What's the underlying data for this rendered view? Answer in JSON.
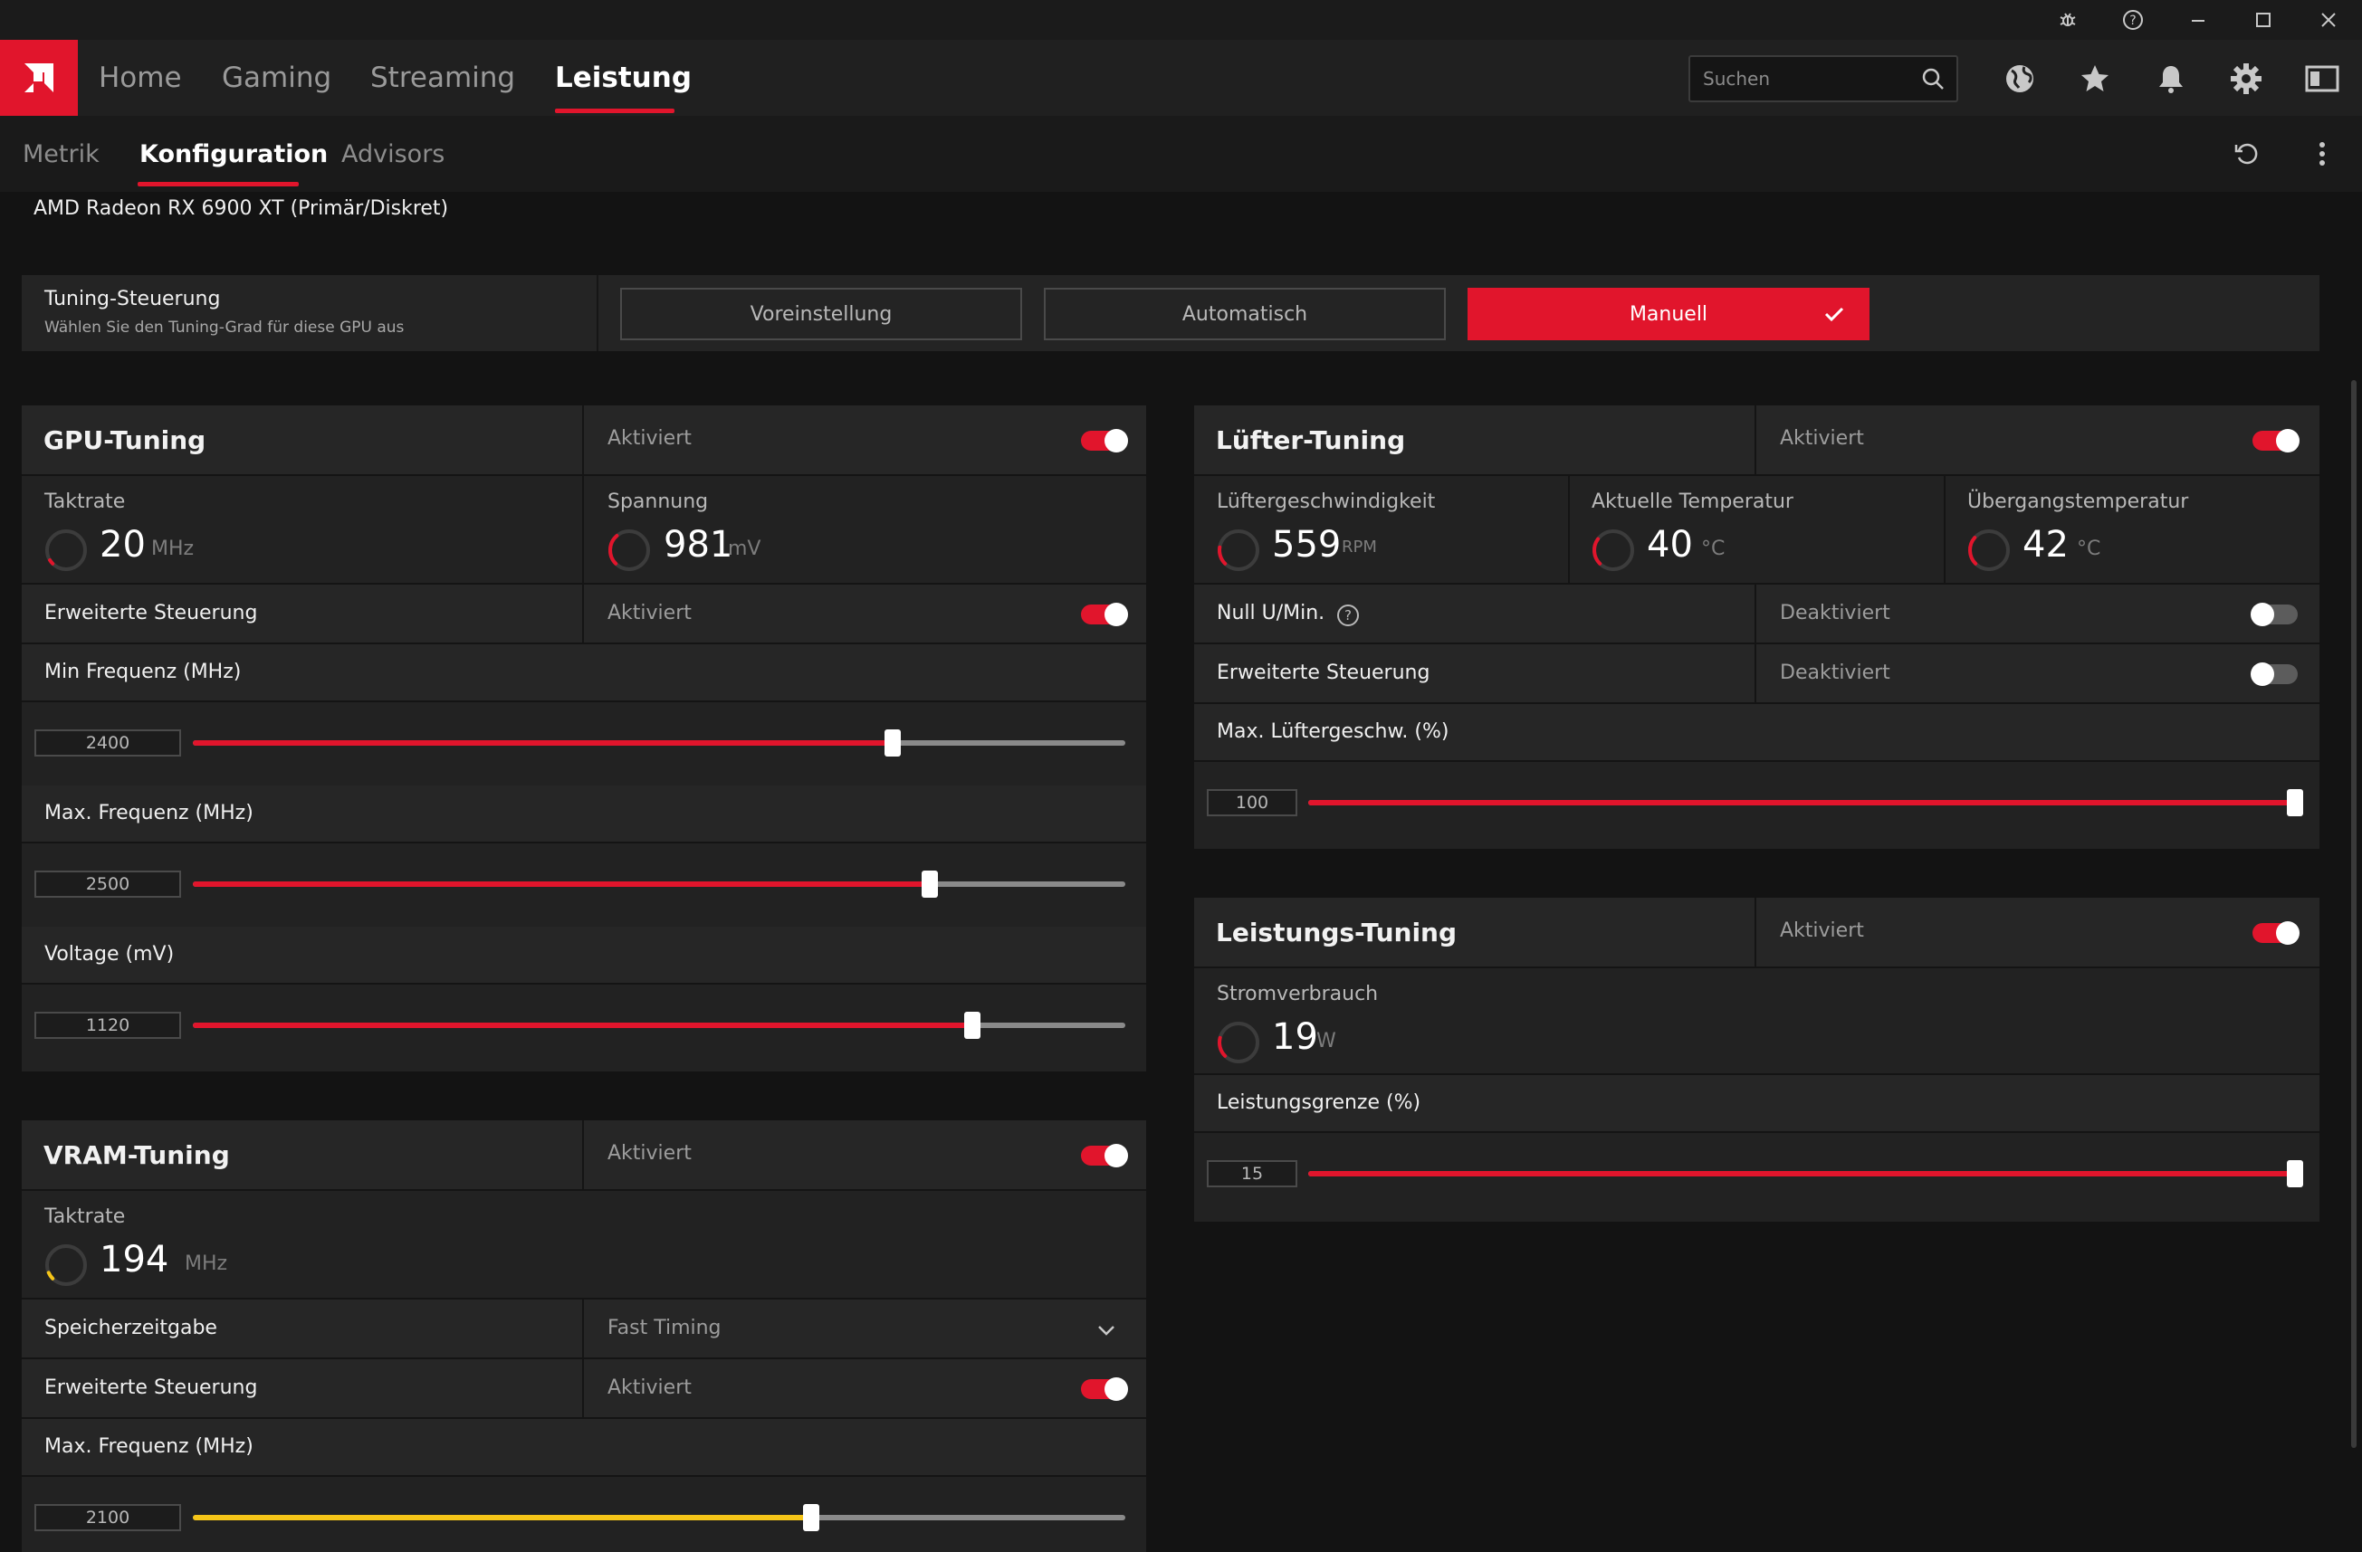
{
  "colors": {
    "accent": "#e1152c",
    "vram_accent": "#f5c518",
    "background": "#131313",
    "panel": "#222222"
  },
  "titlebar": {
    "icons": [
      "bug-icon",
      "help-icon",
      "minimize-icon",
      "maximize-icon",
      "close-icon"
    ]
  },
  "nav": {
    "tabs": [
      {
        "label": "Home",
        "active": false
      },
      {
        "label": "Gaming",
        "active": false
      },
      {
        "label": "Streaming",
        "active": false
      },
      {
        "label": "Leistung",
        "active": true
      }
    ]
  },
  "search": {
    "placeholder": "Suchen",
    "value": ""
  },
  "top_icons": [
    "globe-icon",
    "star-icon",
    "bell-icon",
    "gear-icon",
    "sidebar-icon"
  ],
  "subnav": {
    "tabs": [
      {
        "label": "Metrik",
        "active": false
      },
      {
        "label": "Konfiguration",
        "active": true
      },
      {
        "label": "Advisors",
        "active": false
      }
    ],
    "icons": [
      "reset-icon",
      "more-vertical-icon"
    ]
  },
  "gpu_name": "AMD Radeon RX 6900 XT (Primär/Diskret)",
  "tuning_control": {
    "title": "Tuning-Steuerung",
    "subtitle": "Wählen Sie den Tuning-Grad für diese GPU aus",
    "modes": [
      {
        "label": "Voreinstellung",
        "active": false
      },
      {
        "label": "Automatisch",
        "active": false
      },
      {
        "label": "Manuell",
        "active": true
      }
    ]
  },
  "gpu_tuning": {
    "title": "GPU-Tuning",
    "status": "Aktiviert",
    "enabled": true,
    "clock": {
      "label": "Taktrate",
      "value": "20",
      "unit": "MHz",
      "gauge_fraction": 0.02
    },
    "voltage": {
      "label": "Spannung",
      "value": "981",
      "unit": "mV",
      "gauge_fraction": 0.35
    },
    "advanced": {
      "label": "Erweiterte Steuerung",
      "status": "Aktiviert",
      "enabled": true
    },
    "sliders": [
      {
        "label": "Min Frequenz (MHz)",
        "value": "2400",
        "fraction": 0.75
      },
      {
        "label": "Max. Frequenz (MHz)",
        "value": "2500",
        "fraction": 0.79
      },
      {
        "label": "Voltage (mV)",
        "value": "1120",
        "fraction": 0.836
      }
    ]
  },
  "vram_tuning": {
    "title": "VRAM-Tuning",
    "status": "Aktiviert",
    "enabled": true,
    "clock": {
      "label": "Taktrate",
      "value": "194",
      "unit": "MHz",
      "gauge_fraction": 0.08
    },
    "timing": {
      "label": "Speicherzeitgabe",
      "value": "Fast Timing"
    },
    "advanced": {
      "label": "Erweiterte Steuerung",
      "status": "Aktiviert",
      "enabled": true
    },
    "slider": {
      "label": "Max. Frequenz (MHz)",
      "value": "2100",
      "fraction": 0.663
    }
  },
  "fan_tuning": {
    "title": "Lüfter-Tuning",
    "status": "Aktiviert",
    "enabled": true,
    "metrics": [
      {
        "label": "Lüftergeschwindigkeit",
        "value": "559",
        "unit": "RPM",
        "gauge_fraction": 0.2
      },
      {
        "label": "Aktuelle Temperatur",
        "value": "40",
        "unit": "°C",
        "gauge_fraction": 0.3
      },
      {
        "label": "Übergangstemperatur",
        "value": "42",
        "unit": "°C",
        "gauge_fraction": 0.32
      }
    ],
    "zero_rpm": {
      "label": "Null U/Min.",
      "status": "Deaktiviert",
      "enabled": false
    },
    "advanced": {
      "label": "Erweiterte Steuerung",
      "status": "Deaktiviert",
      "enabled": false
    },
    "slider": {
      "label": "Max. Lüftergeschw. (%)",
      "value": "100",
      "fraction": 1.0
    }
  },
  "power_tuning": {
    "title": "Leistungs-Tuning",
    "status": "Aktiviert",
    "enabled": true,
    "power": {
      "label": "Stromverbrauch",
      "value": "19",
      "unit": "W",
      "gauge_fraction": 0.22
    },
    "slider": {
      "label": "Leistungsgrenze (%)",
      "value": "15",
      "fraction": 1.0
    }
  }
}
